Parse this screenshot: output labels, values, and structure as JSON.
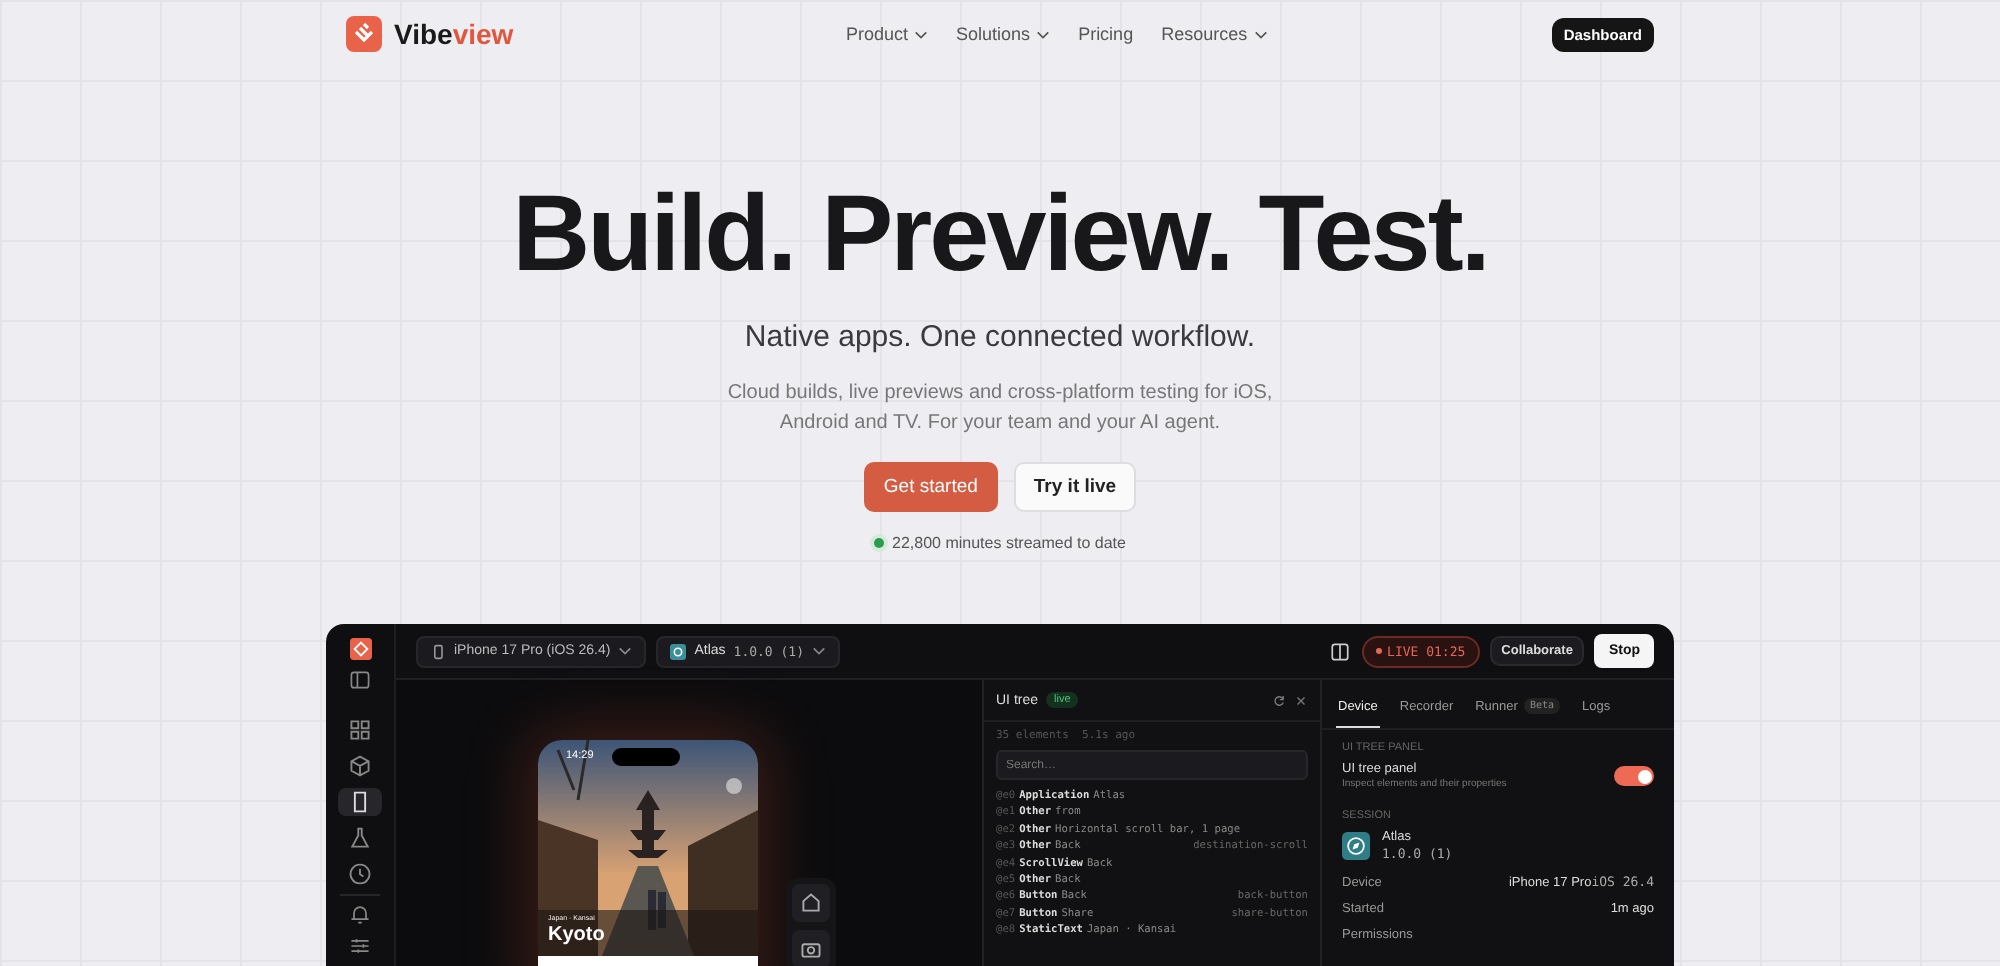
{
  "nav": {
    "brand_a": "Vibe",
    "brand_b": "view",
    "links": [
      {
        "label": "Product",
        "dropdown": true
      },
      {
        "label": "Solutions",
        "dropdown": true
      },
      {
        "label": "Pricing",
        "dropdown": false
      },
      {
        "label": "Resources",
        "dropdown": true
      }
    ],
    "cta": "Dashboard"
  },
  "hero": {
    "title": "Build. Preview. Test.",
    "subtitle": "Native apps. One connected workflow.",
    "description": "Cloud builds, live previews and cross-platform testing for iOS, Android and TV. For your team and your AI agent.",
    "primary": "Get started",
    "secondary": "Try it live",
    "stat": "22,800 minutes streamed to date"
  },
  "app": {
    "rail": [
      {
        "selected": false
      },
      {
        "selected": false
      },
      {
        "selected": true
      },
      {
        "selected": false
      },
      {
        "selected": false
      }
    ],
    "device_select": "iPhone 17 Pro (iOS 26.4)",
    "app_select": "Atlas",
    "app_version": "1.0.0 (1)",
    "live": "LIVE 01:25",
    "collaborate": "Collaborate",
    "stop": "Stop",
    "phone": {
      "time": "14:29",
      "caption": "Japan · Kansai",
      "title": "Kyoto"
    },
    "tree": {
      "title": "UI tree",
      "badge": "live",
      "meta": "35 elements  5.1s ago",
      "placeholder": "Search…",
      "rows": [
        {
          "id": "@e0",
          "type": "Application",
          "label": "Atlas"
        },
        {
          "id": "@e1",
          "type": "Other",
          "label": "from"
        },
        {
          "id": "@e2",
          "type": "Other",
          "label": "Horizontal scroll bar, 1 page"
        },
        {
          "id": "@e3",
          "type": "Other",
          "label": "Back",
          "ref": "destination-scroll"
        },
        {
          "id": "@e4",
          "type": "ScrollView",
          "label": "Back"
        },
        {
          "id": "@e5",
          "type": "Other",
          "label": "Back"
        },
        {
          "id": "@e6",
          "type": "Button",
          "label": "Back",
          "ref": "back-button"
        },
        {
          "id": "@e7",
          "type": "Button",
          "label": "Share",
          "ref": "share-button"
        },
        {
          "id": "@e8",
          "type": "StaticText",
          "label": "Japan · Kansai"
        }
      ]
    },
    "tabs": [
      {
        "label": "Device",
        "selected": true
      },
      {
        "label": "Recorder",
        "selected": false
      },
      {
        "label": "Runner",
        "badge": "Beta",
        "selected": false
      },
      {
        "label": "Logs",
        "selected": false
      }
    ],
    "panel_heading": "UI TREE PANEL",
    "toggle": {
      "label": "UI tree panel",
      "hint": "Inspect elements and their properties",
      "on": true
    },
    "session_heading": "SESSION",
    "session_app": "Atlas",
    "session_version": "1.0.0 (1)",
    "props": [
      {
        "key": "Device",
        "value": "iPhone 17 Pro",
        "extra": "iOS 26.4"
      },
      {
        "key": "Started",
        "value": "1m ago"
      },
      {
        "key": "Permissions"
      }
    ]
  }
}
